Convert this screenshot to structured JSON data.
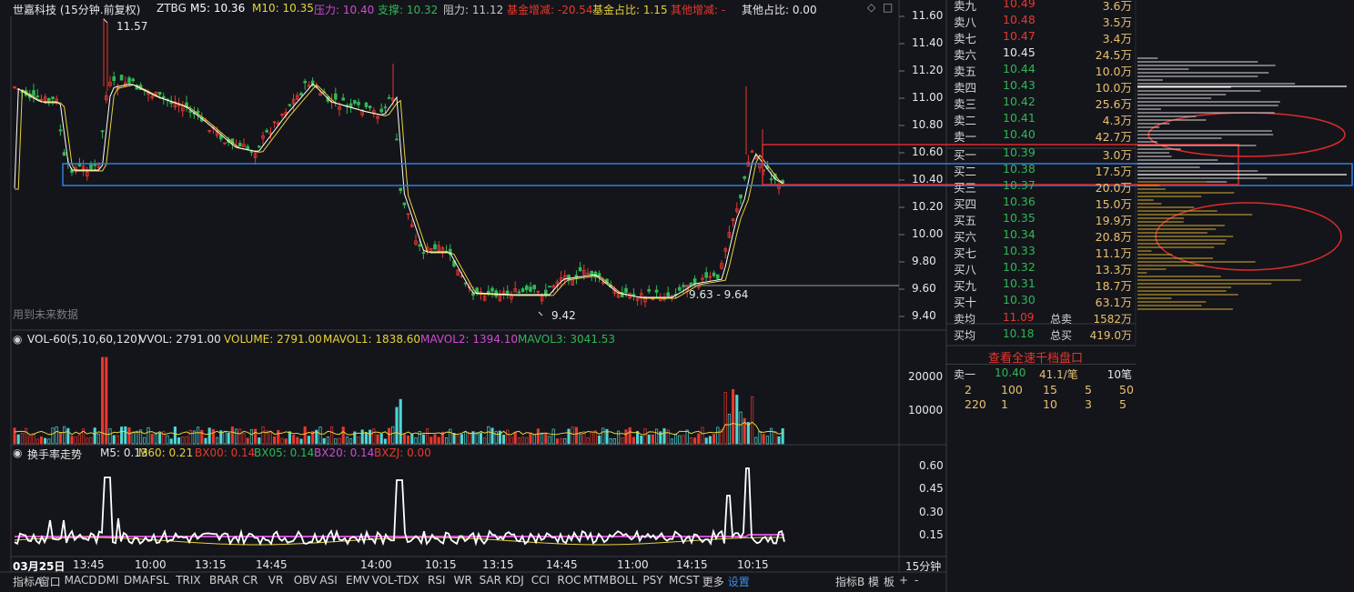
{
  "colors": {
    "bg": "#14151a",
    "up": "#e8382e",
    "down": "#2fb856",
    "ma5": "#ffffff",
    "ma10": "#e8d23a",
    "grid": "#2a2c33",
    "accent": "#3a8ee6",
    "orange": "#f0a040",
    "magenta": "#d14ad8"
  },
  "header": {
    "title": "世嘉科技 (15分钟.前复权)",
    "code": "ZTBG",
    "ma5": "M5: 10.36",
    "ma10": "M10: 10.35",
    "pressure": "压力: 10.40",
    "support": "支撑: 10.32",
    "resistance": "阻力: 11.12",
    "fund_change": "基金增减: -20.54",
    "fund_ratio": "基金占比: 1.15",
    "other_change": "其他增减: -",
    "other_ratio": "其他占比: 0.00"
  },
  "main_chart": {
    "y_ticks": [
      "11.60",
      "11.40",
      "11.20",
      "11.00",
      "10.80",
      "10.60",
      "10.40",
      "10.20",
      "10.00",
      "9.80",
      "9.60",
      "9.40"
    ],
    "high_label": "11.57",
    "low_label": "9.42",
    "range_label": "9.63 - 9.64",
    "future_data_label": "用到未来数据"
  },
  "volume_panel": {
    "title": "VOL-60(5,10,60,120)",
    "vvol": "VVOL: 2791.00",
    "volume": "VOLUME: 2791.00",
    "mavol1": "MAVOL1: 1838.60",
    "mavol2": "MAVOL2: 1394.10",
    "mavol3": "MAVOL3: 3041.53",
    "y_ticks": [
      "20000",
      "10000"
    ]
  },
  "turnover_panel": {
    "title": "换手率走势",
    "m5": "M5: 0.13",
    "m60": "M60: 0.21",
    "bx00": "BX00: 0.14",
    "bx05": "BX05: 0.14",
    "bx20": "BX20: 0.14",
    "bxzj": "BXZJ: 0.00",
    "y_ticks": [
      "0.60",
      "0.45",
      "0.30",
      "0.15"
    ]
  },
  "x_axis": {
    "labels": [
      "03月25日",
      "13:45",
      "10:00",
      "13:15",
      "14:45",
      "14:00",
      "10:15",
      "13:15",
      "14:45",
      "11:00",
      "14:15",
      "10:15"
    ],
    "period": "15分钟"
  },
  "order_book": {
    "asks": [
      {
        "name": "卖九",
        "price": "10.49",
        "vol": "3.6万"
      },
      {
        "name": "卖八",
        "price": "10.48",
        "vol": "3.5万"
      },
      {
        "name": "卖七",
        "price": "10.47",
        "vol": "3.4万"
      },
      {
        "name": "卖六",
        "price": "10.45",
        "vol": "24.5万"
      },
      {
        "name": "卖五",
        "price": "10.44",
        "vol": "10.0万"
      },
      {
        "name": "卖四",
        "price": "10.43",
        "vol": "10.0万"
      },
      {
        "name": "卖三",
        "price": "10.42",
        "vol": "25.6万"
      },
      {
        "name": "卖二",
        "price": "10.41",
        "vol": "4.3万"
      },
      {
        "name": "卖一",
        "price": "10.40",
        "vol": "42.7万"
      }
    ],
    "bids": [
      {
        "name": "买一",
        "price": "10.39",
        "vol": "3.0万"
      },
      {
        "name": "买二",
        "price": "10.38",
        "vol": "17.5万"
      },
      {
        "name": "买三",
        "price": "10.37",
        "vol": "20.0万"
      },
      {
        "name": "买四",
        "price": "10.36",
        "vol": "15.0万"
      },
      {
        "name": "买五",
        "price": "10.35",
        "vol": "19.9万"
      },
      {
        "name": "买六",
        "price": "10.34",
        "vol": "20.8万"
      },
      {
        "name": "买七",
        "price": "10.33",
        "vol": "11.1万"
      },
      {
        "name": "买八",
        "price": "10.32",
        "vol": "13.3万"
      },
      {
        "name": "买九",
        "price": "10.31",
        "vol": "18.7万"
      },
      {
        "name": "买十",
        "price": "10.30",
        "vol": "63.1万"
      }
    ],
    "ask_avg_label": "卖均",
    "ask_avg": "11.09",
    "total_ask_label": "总卖",
    "total_ask": "1582万",
    "bid_avg_label": "买均",
    "bid_avg": "10.18",
    "total_bid_label": "总买",
    "total_bid": "419.0万",
    "view_all_button": "查看全速千档盘口",
    "sell1_label": "卖一",
    "sell1_price": "10.40",
    "sell1_per": "41.1/笔",
    "sell1_count": "10笔",
    "queue_row1": [
      "2",
      "100",
      "15",
      "5",
      "50"
    ],
    "queue_row2": [
      "220",
      "1",
      "10",
      "3",
      "5"
    ]
  },
  "toolbar": {
    "left_items": [
      "指标A",
      "窗口",
      "MACD",
      "DMI",
      "DMA",
      "FSL",
      "TRIX",
      "BRAR",
      "CR",
      "VR",
      "OBV",
      "ASI",
      "EMV",
      "VOL-TDX",
      "RSI",
      "WR",
      "SAR",
      "KDJ",
      "CCI",
      "ROC",
      "MTM",
      "BOLL",
      "PSY",
      "MCST",
      "更多",
      "设置"
    ],
    "right_items": [
      "指标B",
      "模",
      "板",
      "+",
      "-"
    ]
  }
}
